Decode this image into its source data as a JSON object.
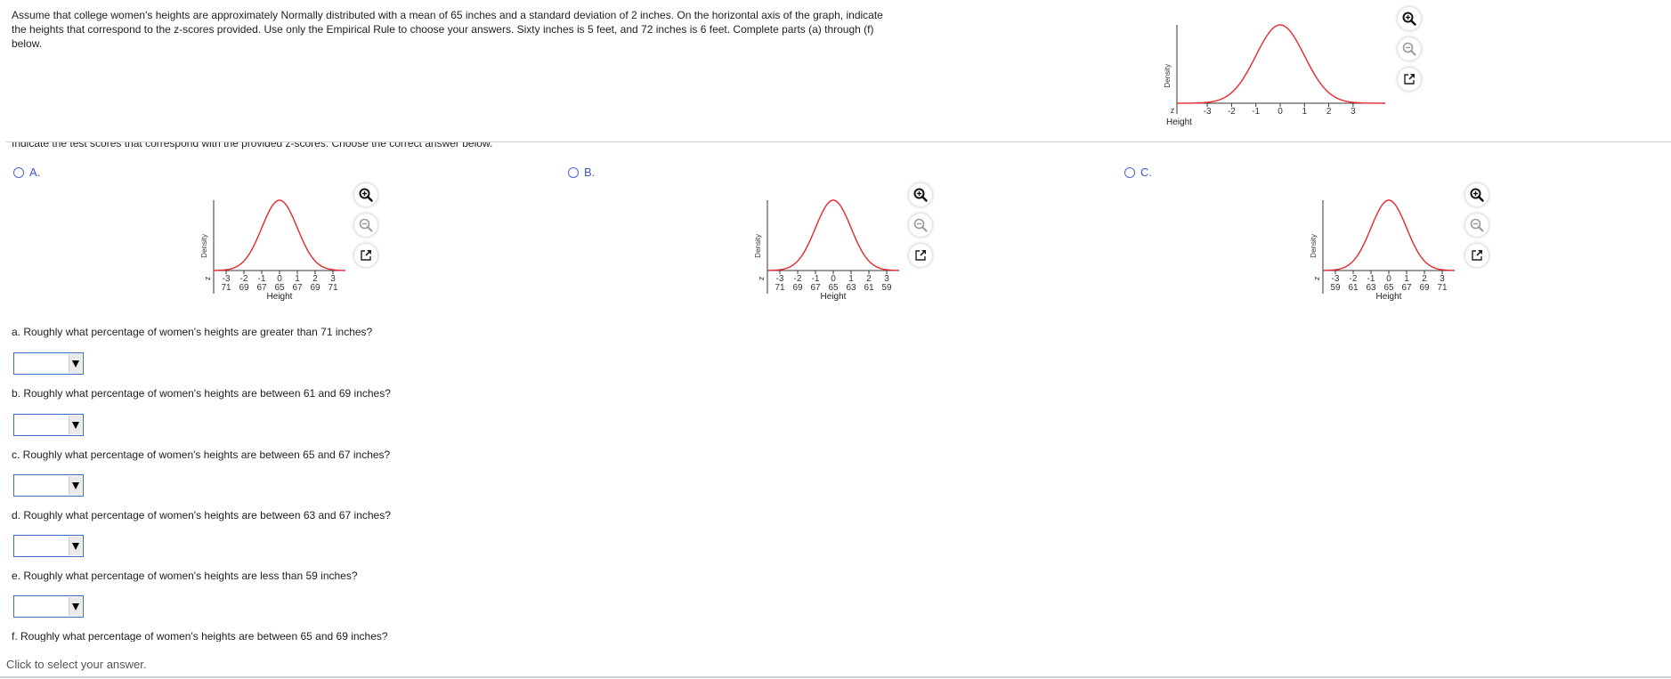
{
  "problem": {
    "intro": "Assume that college women's heights are approximately Normally distributed with a mean of 65 inches and a standard deviation of 2 inches. On the horizontal axis of the graph, indicate the heights that correspond to the z-scores provided. Use only the Empirical Rule to choose your answers. Sixty inches is 5 feet, and 72 inches is 6 feet. Complete parts (a) through (f) below.",
    "instruction": "Indicate the test scores that correspond with the provided z-scores. Choose the correct answer below."
  },
  "icons": {
    "zoom_in": "zoom-in-icon",
    "zoom_out": "zoom-out-icon",
    "pop_out": "pop-out-icon",
    "radio": "radio-button-icon",
    "dropdown_arrow": "triangle-down-icon"
  },
  "colors": {
    "curve": "#e8282b",
    "choice_label": "#3a55c8",
    "dropdown_border": "#3a6ec6"
  },
  "chart_data": [
    {
      "id": "reference",
      "type": "line",
      "title": "",
      "ylabel": "Density",
      "xlabel": "Height",
      "row_label_z": "z",
      "z_ticks": [
        "-3",
        "-2",
        "-1",
        "0",
        "1",
        "2",
        "3"
      ],
      "height_ticks": [],
      "curve": "standard normal density",
      "xlim": [
        -4.2,
        4.2
      ]
    },
    {
      "id": "A",
      "type": "line",
      "ylabel": "Density",
      "xlabel": "Height",
      "row_label_z": "z",
      "z_ticks": [
        "-3",
        "-2",
        "-1",
        "0",
        "1",
        "2",
        "3"
      ],
      "height_ticks": [
        "71",
        "69",
        "67",
        "65",
        "67",
        "69",
        "71"
      ],
      "curve": "standard normal density",
      "xlim": [
        -4.2,
        4.2
      ]
    },
    {
      "id": "B",
      "type": "line",
      "ylabel": "Density",
      "xlabel": "Height",
      "row_label_z": "z",
      "z_ticks": [
        "-3",
        "-2",
        "-1",
        "0",
        "1",
        "2",
        "3"
      ],
      "height_ticks": [
        "71",
        "69",
        "67",
        "65",
        "63",
        "61",
        "59"
      ],
      "curve": "standard normal density",
      "xlim": [
        -4.2,
        4.2
      ]
    },
    {
      "id": "C",
      "type": "line",
      "ylabel": "Density",
      "xlabel": "Height",
      "row_label_z": "z",
      "z_ticks": [
        "-3",
        "-2",
        "-1",
        "0",
        "1",
        "2",
        "3"
      ],
      "height_ticks": [
        "59",
        "61",
        "63",
        "65",
        "67",
        "69",
        "71"
      ],
      "curve": "standard normal density",
      "xlim": [
        -4.2,
        4.2
      ]
    }
  ],
  "choices": [
    {
      "letter": "A.",
      "selected": false
    },
    {
      "letter": "B.",
      "selected": false
    },
    {
      "letter": "C.",
      "selected": false
    }
  ],
  "questions": [
    {
      "label": "a. Roughly what percentage of women's heights are greater than 71 inches?",
      "value": ""
    },
    {
      "label": "b. Roughly what percentage of women's heights are between 61 and 69 inches?",
      "value": ""
    },
    {
      "label": "c. Roughly what percentage of women's heights are between 65 and 67 inches?",
      "value": ""
    },
    {
      "label": "d. Roughly what percentage of women's heights are between 63 and 67 inches?",
      "value": ""
    },
    {
      "label": "e. Roughly what percentage of women's heights are less than 59 inches?",
      "value": ""
    },
    {
      "label": "f. Roughly what percentage of women's heights are between 65 and 69 inches?",
      "value": ""
    }
  ],
  "status": "Click to select your answer."
}
